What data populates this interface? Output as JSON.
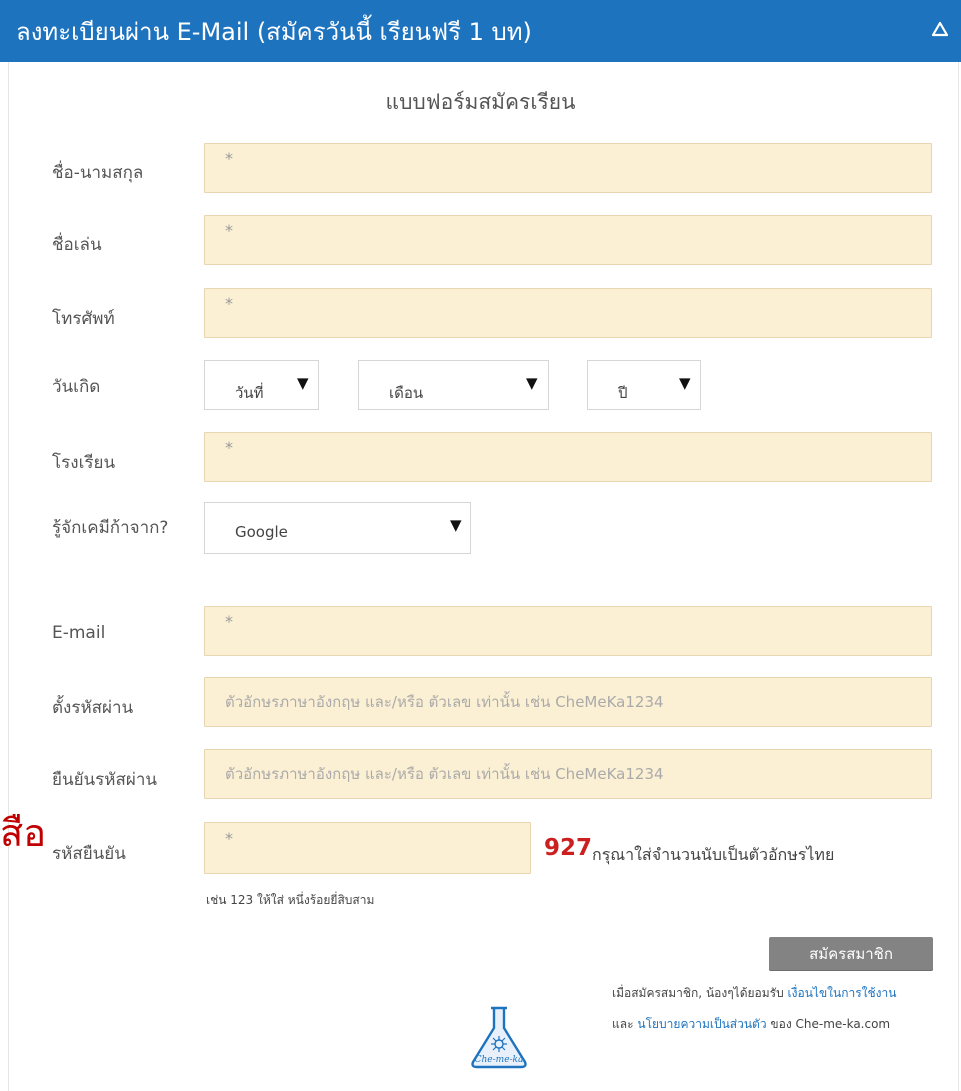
{
  "header": {
    "title": "ลงทะเบียนผ่าน E-Mail (สมัครวันนี้ เรียนฟรี 1 บท)",
    "collapse_icon": "chevron-up-icon",
    "color": "#1e73be"
  },
  "form": {
    "title": "แบบฟอร์มสมัครเรียน",
    "fields": {
      "fullname": {
        "label": "ชื่อ-นามสกุล",
        "value": "*"
      },
      "nickname": {
        "label": "ชื่อเล่น",
        "value": "*"
      },
      "phone": {
        "label": "โทรศัพท์",
        "value": "*"
      },
      "birthday": {
        "label": "วันเกิด",
        "day": "วันที่",
        "month": "เดือน",
        "year": "ปี"
      },
      "school": {
        "label": "โรงเรียน",
        "value": "*"
      },
      "referral": {
        "label": "รู้จักเคมีก้าจาก?",
        "selected": "Google"
      },
      "email": {
        "label": "E-mail",
        "value": "*"
      },
      "password": {
        "label": "ตั้งรหัสผ่าน",
        "placeholder": "ตัวอักษรภาษาอังกฤษ และ/หรือ ตัวเลข เท่านั้น เช่น CheMeKa1234"
      },
      "confirm_password": {
        "label": "ยืนยันรหัสผ่าน",
        "placeholder": "ตัวอักษรภาษาอังกฤษ และ/หรือ ตัวเลข เท่านั้น เช่น CheMeKa1234"
      },
      "captcha": {
        "label": "รหัสยืนยัน",
        "value": "*",
        "number": "927",
        "hint": "กรุณาใส่จำนวนนับเป็นตัวอักษรไทย",
        "example": "เช่น 123 ให้ใส่ หนึ่งร้อยยี่สิบสาม"
      }
    },
    "submit_label": "สมัครสมาชิก",
    "terms": {
      "line1_prefix": "เมื่อสมัครสมาชิก, น้องๆได้ยอมรับ",
      "line1_link": "เงื่อนไขในการใช้งาน",
      "line2_prefix": "และ",
      "line2_link": "นโยบายความเป็นส่วนตัว",
      "line2_suffix": "ของ Che-me-ka.com"
    },
    "logo_text": "Che-me-ka",
    "input_bg": "#fcf0d4",
    "accent_red": "#cc1f1f"
  },
  "side_text": "สือ"
}
